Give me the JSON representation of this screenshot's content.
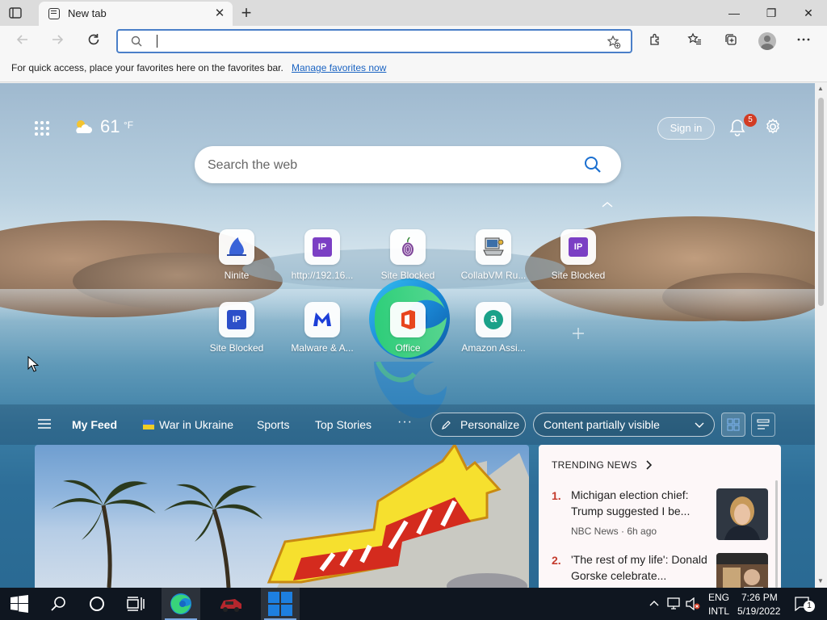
{
  "browser": {
    "tab_title": "New tab",
    "tab_close": "✕",
    "new_tab_glyph": "+",
    "window_buttons": {
      "minimize": "—",
      "restore": "❐",
      "close": "✕"
    },
    "address": {
      "value": "",
      "placeholder": ""
    },
    "favorites_bar": {
      "text": "For quick access, place your favorites here on the favorites bar.",
      "link": "Manage favorites now"
    }
  },
  "ntp": {
    "weather": {
      "temp": "61",
      "unit": "°F"
    },
    "sign_in": "Sign in",
    "notifications": "5",
    "search_placeholder": "Search the web",
    "quick_links": [
      {
        "label": "Ninite",
        "icon": "ninite-icon"
      },
      {
        "label": "http://192.16...",
        "icon": "ip-icon",
        "glyph": "IP"
      },
      {
        "label": "Site Blocked",
        "icon": "tor-icon"
      },
      {
        "label": "CollabVM Ru...",
        "icon": "collabvm-icon"
      },
      {
        "label": "Site Blocked",
        "icon": "ip-icon",
        "glyph": "IP"
      },
      {
        "label": "Site Blocked",
        "icon": "ip-icon",
        "glyph": "IP"
      },
      {
        "label": "Malware & A...",
        "icon": "malwarebytes-icon"
      },
      {
        "label": "Office",
        "icon": "office-icon"
      },
      {
        "label": "Amazon Assi...",
        "icon": "amazon-assistant-icon",
        "glyph": "a"
      }
    ],
    "feed_nav": {
      "my_feed": "My Feed",
      "war": "War in Ukraine",
      "sports": "Sports",
      "top_stories": "Top Stories",
      "more": "···",
      "personalize": "Personalize",
      "visibility": "Content partially visible"
    },
    "trending": {
      "title": "TRENDING NEWS",
      "items": [
        {
          "num": "1.",
          "headline": "Michigan election chief: Trump suggested I be...",
          "source": "NBC News · 6h ago"
        },
        {
          "num": "2.",
          "headline": "'The rest of my life': Donald Gorske celebrate...",
          "source": ""
        }
      ]
    }
  },
  "taskbar": {
    "lang": "ENG",
    "layout": "INTL",
    "time": "7:26 PM",
    "date": "5/19/2022",
    "notification_count": "1"
  },
  "colors": {
    "accent": "#4a7fc8",
    "link": "#1a63c2",
    "badge": "#d23c24",
    "trending_number": "#c43b2d",
    "ip_purple": "#7b3fc4",
    "ip_blue": "#2c4fc9"
  }
}
